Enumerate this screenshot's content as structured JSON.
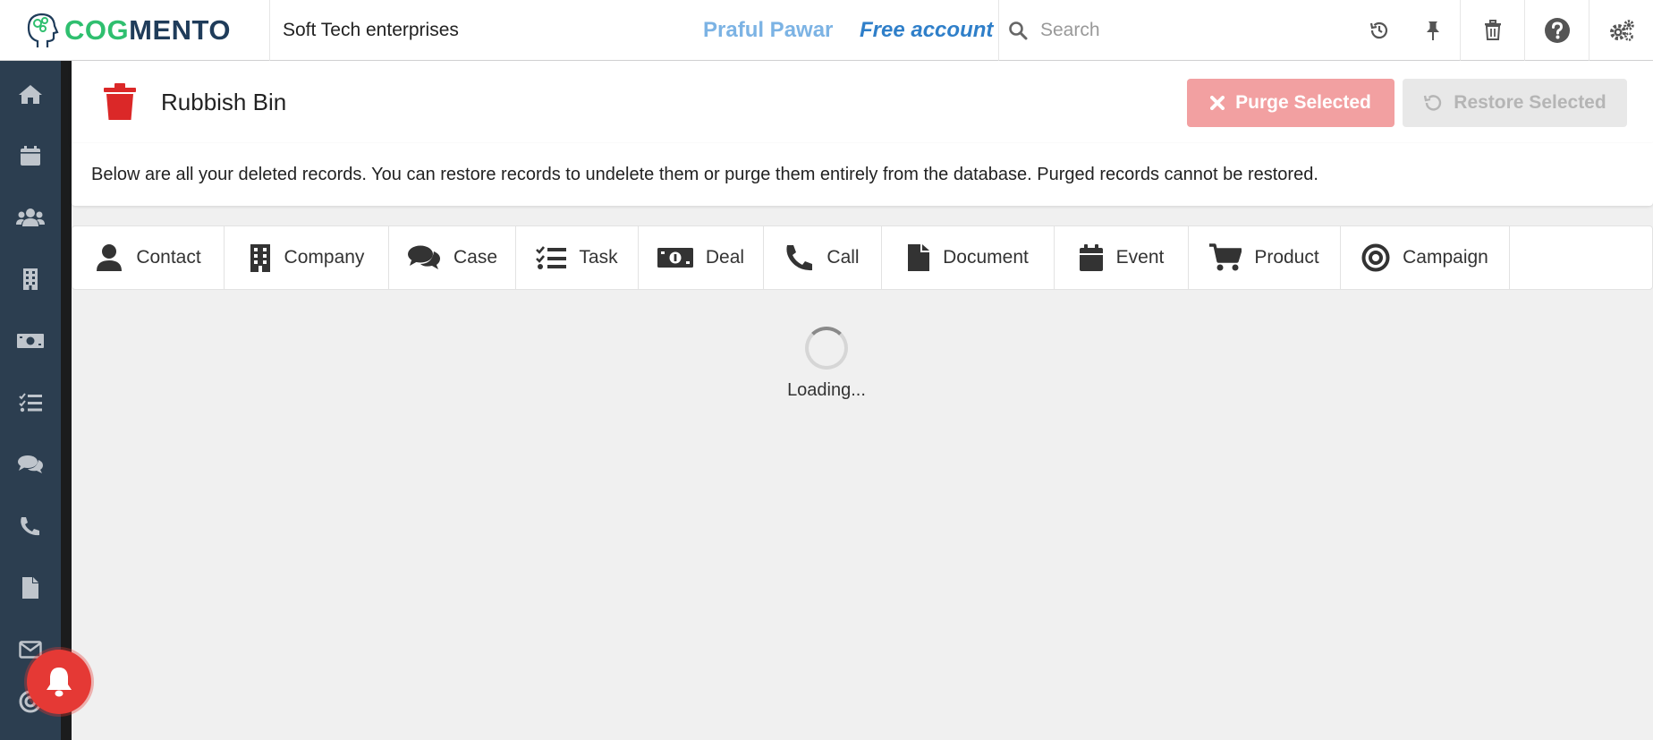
{
  "brand": {
    "logo_part1": "COG",
    "logo_part2": "MENTO",
    "accent": "#2fbf6f",
    "dark": "#1f3c5a"
  },
  "topbar": {
    "company": "Soft Tech enterprises",
    "user_name": "Praful Pawar",
    "account_type": "Free account",
    "search_placeholder": "Search",
    "icons": [
      "history-icon",
      "pin-icon",
      "trash-icon",
      "help-icon",
      "settings-icon"
    ]
  },
  "sidebar": {
    "items": [
      "home-icon",
      "calendar-icon",
      "contacts-icon",
      "company-icon",
      "deals-icon",
      "tasks-icon",
      "cases-icon",
      "calls-icon",
      "documents-icon",
      "email-icon",
      "campaigns-icon"
    ]
  },
  "header": {
    "title": "Rubbish Bin",
    "purge_label": "Purge Selected",
    "restore_label": "Restore Selected"
  },
  "info": {
    "message": "Below are all your deleted records. You can restore records to undelete them or purge them entirely from the database. Purged records cannot be restored."
  },
  "tabs": [
    {
      "label": "Contact",
      "icon": "user-icon"
    },
    {
      "label": "Company",
      "icon": "building-icon"
    },
    {
      "label": "Case",
      "icon": "comments-icon"
    },
    {
      "label": "Task",
      "icon": "tasks-icon"
    },
    {
      "label": "Deal",
      "icon": "money-icon"
    },
    {
      "label": "Call",
      "icon": "phone-icon"
    },
    {
      "label": "Document",
      "icon": "file-icon"
    },
    {
      "label": "Event",
      "icon": "calendar-icon"
    },
    {
      "label": "Product",
      "icon": "cart-icon"
    },
    {
      "label": "Campaign",
      "icon": "bullseye-icon"
    }
  ],
  "loading": {
    "text": "Loading..."
  },
  "colors": {
    "sidebar": "#2c3e50",
    "purge": "#f2a0a1",
    "bin_icon": "#db2828",
    "bell": "#e53935"
  }
}
